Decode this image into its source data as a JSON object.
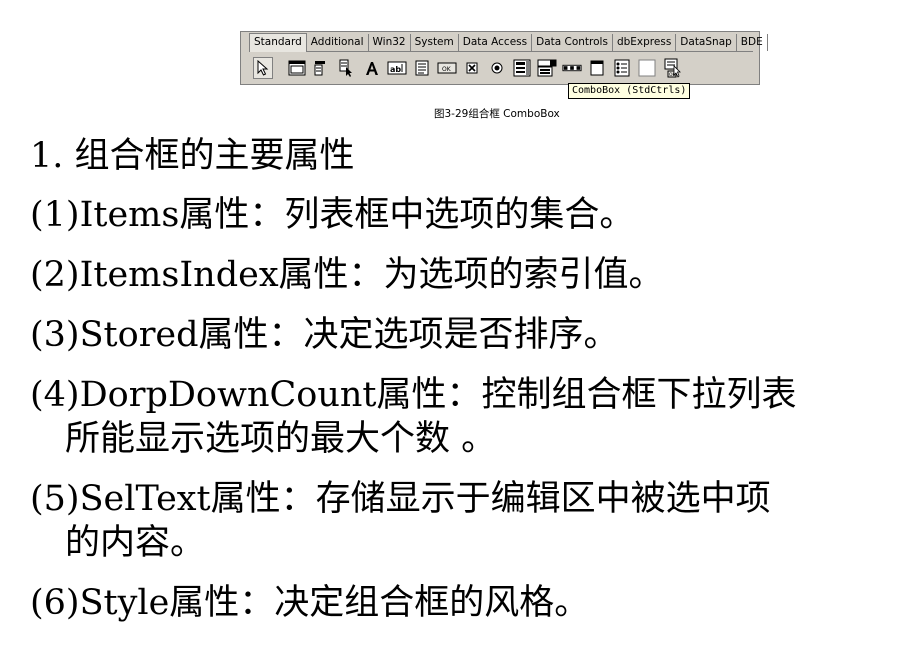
{
  "palette": {
    "tabs": [
      "Standard",
      "Additional",
      "Win32",
      "System",
      "Data Access",
      "Data Controls",
      "dbExpress",
      "DataSnap",
      "BDE"
    ],
    "active_tab": "Standard",
    "tooltip": "ComboBox (StdCtrls)"
  },
  "caption": "图3-29组合框 ComboBox",
  "heading": "1. 组合框的主要属性",
  "items": [
    {
      "text": "(1)Items属性：列表框中选项的集合。",
      "cont": ""
    },
    {
      "text": "(2)ItemsIndex属性：为选项的索引值。",
      "cont": ""
    },
    {
      "text": "(3)Stored属性：决定选项是否排序。",
      "cont": ""
    },
    {
      "text": "(4)DorpDownCount属性：控制组合框下拉列表",
      "cont": "所能显示选项的最大个数 。"
    },
    {
      "text": "(5)SelText属性：存储显示于编辑区中被选中项",
      "cont": "的内容。"
    },
    {
      "text": "(6)Style属性：决定组合框的风格。",
      "cont": ""
    }
  ],
  "icons": [
    "pointer-icon",
    "frames-icon",
    "mainmenu-icon",
    "popupmenu-icon",
    "label-icon",
    "edit-icon",
    "memo-icon",
    "button-icon",
    "checkbox-icon",
    "radiobutton-icon",
    "listbox-icon",
    "combobox-icon",
    "scrollbar-icon",
    "groupbox-icon",
    "radiogroup-icon",
    "panel-icon",
    "actionlist-icon"
  ]
}
